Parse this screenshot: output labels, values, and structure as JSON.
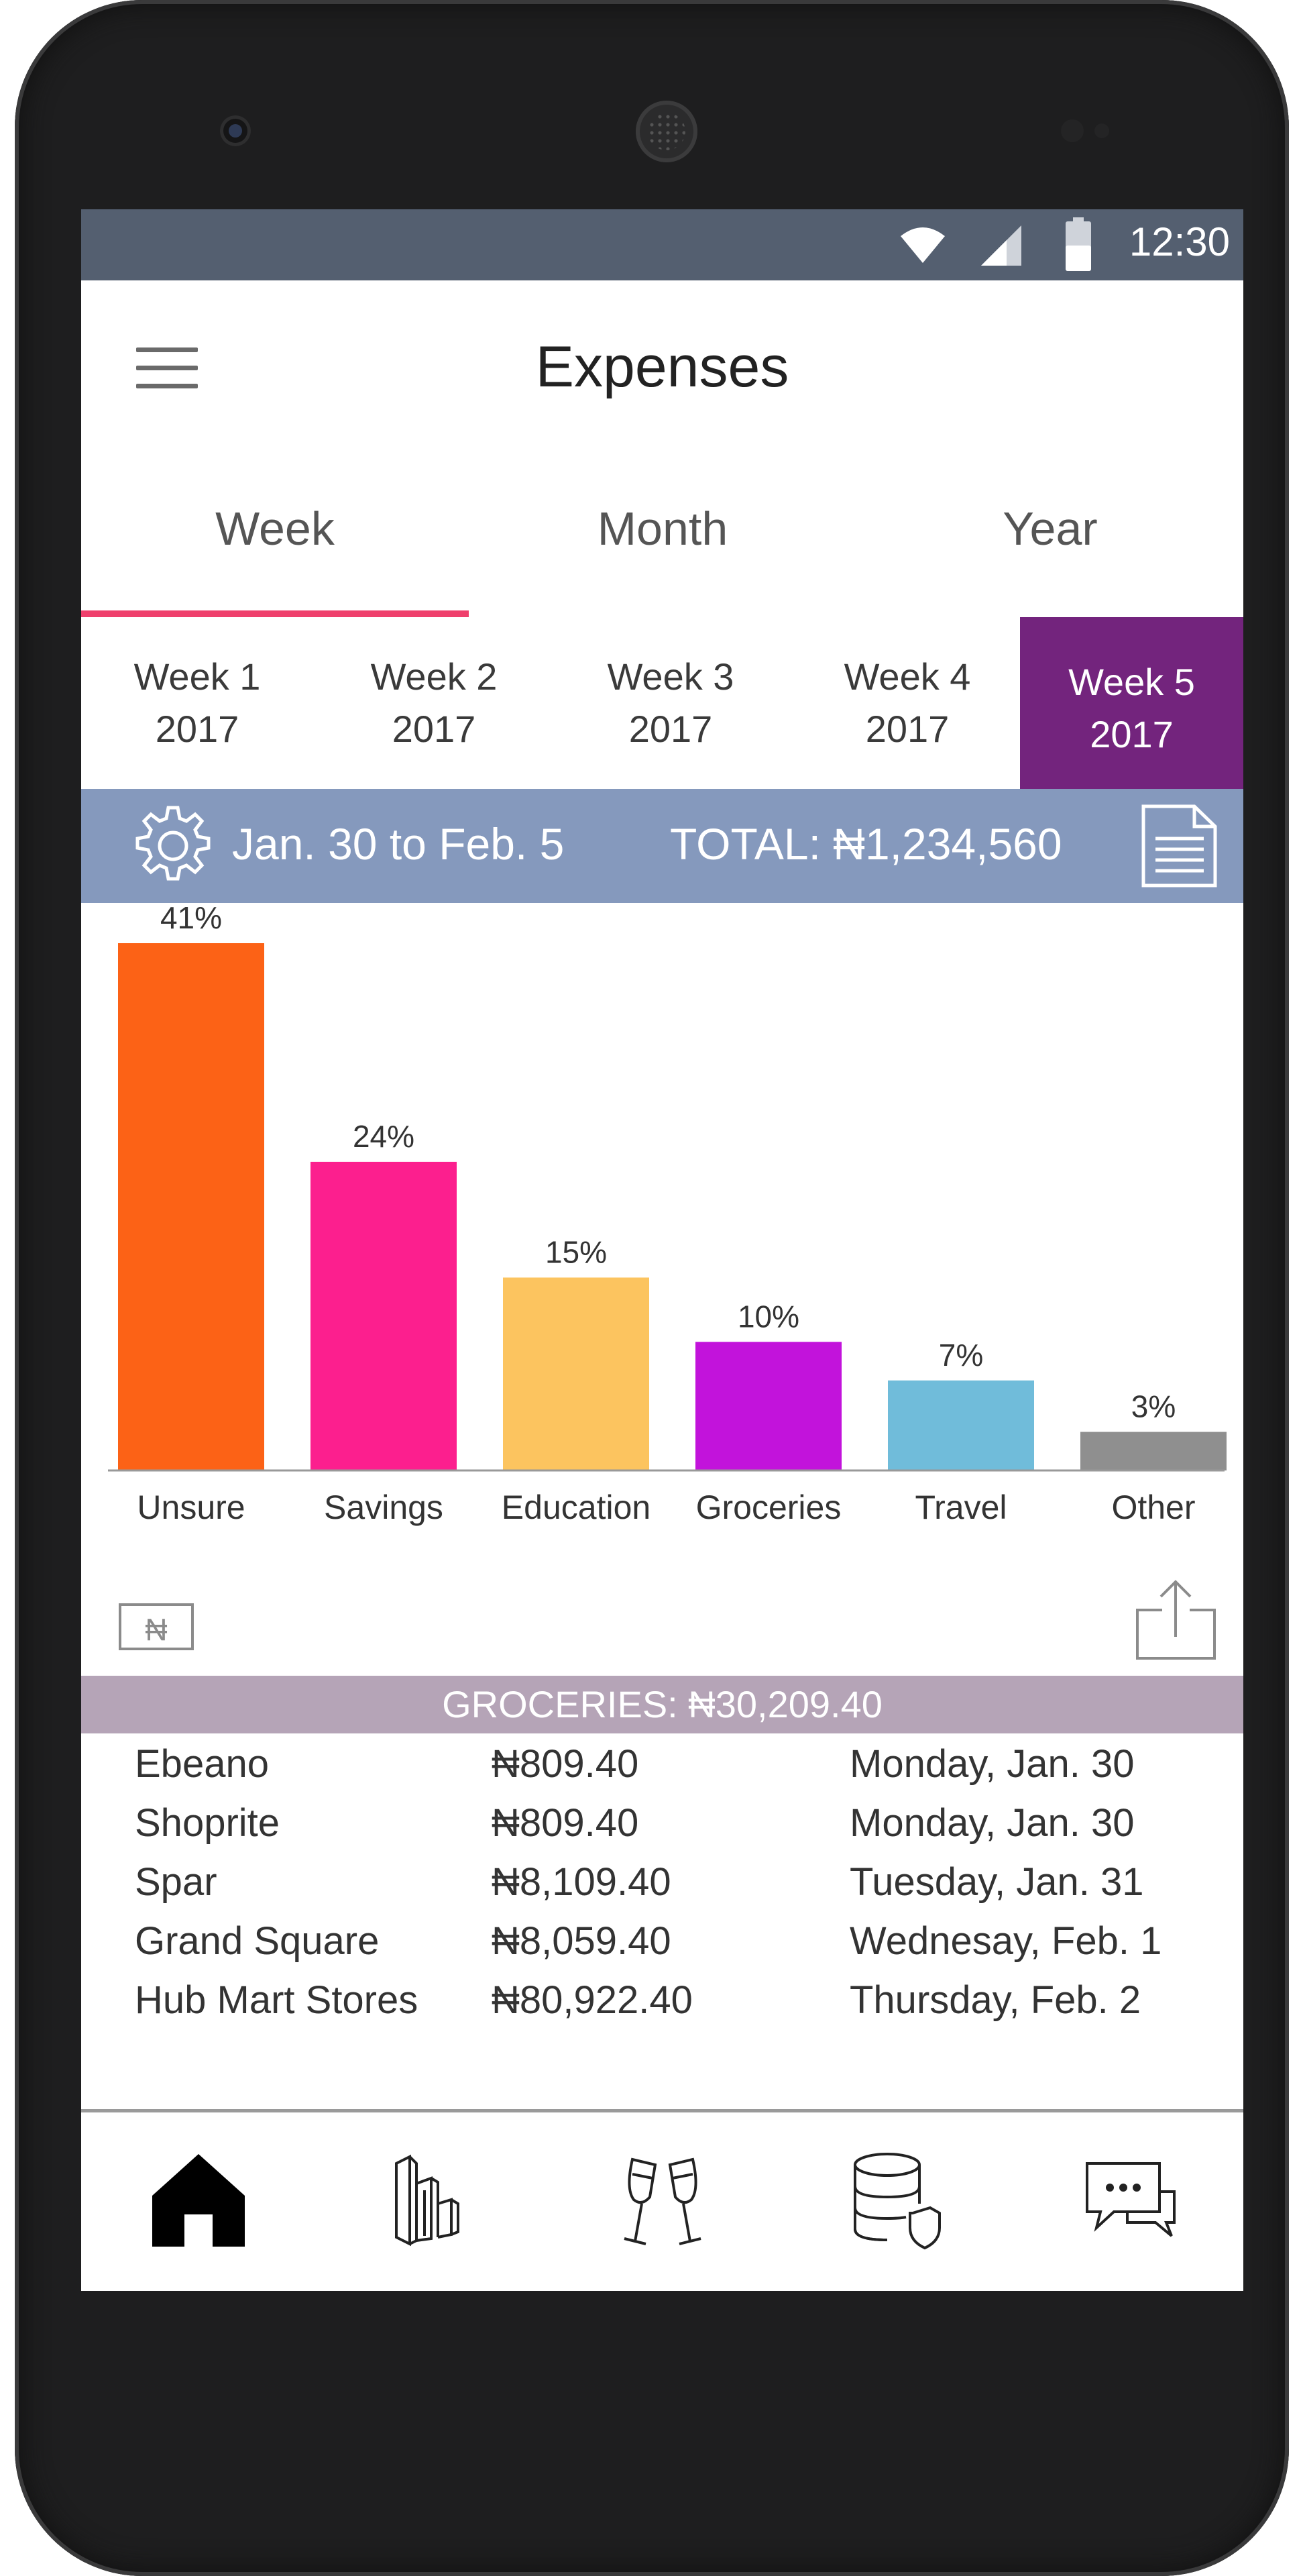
{
  "status": {
    "time": "12:30"
  },
  "header": {
    "title": "Expenses"
  },
  "period_tabs": [
    {
      "label": "Week",
      "active": true
    },
    {
      "label": "Month",
      "active": false
    },
    {
      "label": "Year",
      "active": false
    }
  ],
  "weeks": [
    {
      "line1": "Week 1",
      "line2": "2017",
      "active": false
    },
    {
      "line1": "Week 2",
      "line2": "2017",
      "active": false
    },
    {
      "line1": "Week 3",
      "line2": "2017",
      "active": false
    },
    {
      "line1": "Week 4",
      "line2": "2017",
      "active": false
    },
    {
      "line1": "Week 5",
      "line2": "2017",
      "active": true
    }
  ],
  "summary": {
    "date_range": "Jan. 30 to Feb. 5",
    "total": "TOTAL: ₦1,234,560",
    "settings_icon": "gear-icon",
    "report_icon": "document-icon"
  },
  "chart_data": {
    "type": "bar",
    "categories": [
      "Unsure",
      "Savings",
      "Education",
      "Groceries",
      "Travel",
      "Other"
    ],
    "values": [
      41,
      24,
      15,
      10,
      7,
      3
    ],
    "value_labels": [
      "41%",
      "24%",
      "15%",
      "10%",
      "7%",
      "3%"
    ],
    "colors": [
      "#fc6216",
      "#fc1f8e",
      "#fcc45f",
      "#c213db",
      "#70bcda",
      "#8f8f8f"
    ],
    "unit": "%",
    "grid": false,
    "legend": "none"
  },
  "tools": {
    "currency_label": "₦",
    "share_icon": "share-icon"
  },
  "category_detail": {
    "heading": "GROCERIES: ₦30,209.40",
    "rows": [
      {
        "store": "Ebeano",
        "amount": "₦809.40",
        "date": "Monday, Jan. 30"
      },
      {
        "store": "Shoprite",
        "amount": "₦809.40",
        "date": "Monday, Jan. 30"
      },
      {
        "store": "Spar",
        "amount": "₦8,109.40",
        "date": "Tuesday, Jan. 31"
      },
      {
        "store": "Grand Square",
        "amount": "₦8,059.40",
        "date": "Wednesay, Feb. 1"
      },
      {
        "store": "Hub Mart Stores",
        "amount": "₦80,922.40",
        "date": "Thursday, Feb. 2"
      }
    ]
  },
  "bottom_nav": [
    {
      "icon": "home-icon",
      "active": true
    },
    {
      "icon": "buildings-icon",
      "active": false
    },
    {
      "icon": "cheers-icon",
      "active": false
    },
    {
      "icon": "database-shield-icon",
      "active": false
    },
    {
      "icon": "chat-icon",
      "active": false
    }
  ],
  "colors": {
    "status_bar": "#545f70",
    "tab_indicator": "#ef3f6c",
    "active_week": "#73247d",
    "summary_bar": "#8599bd",
    "category_bar": "#b5a4b7"
  }
}
